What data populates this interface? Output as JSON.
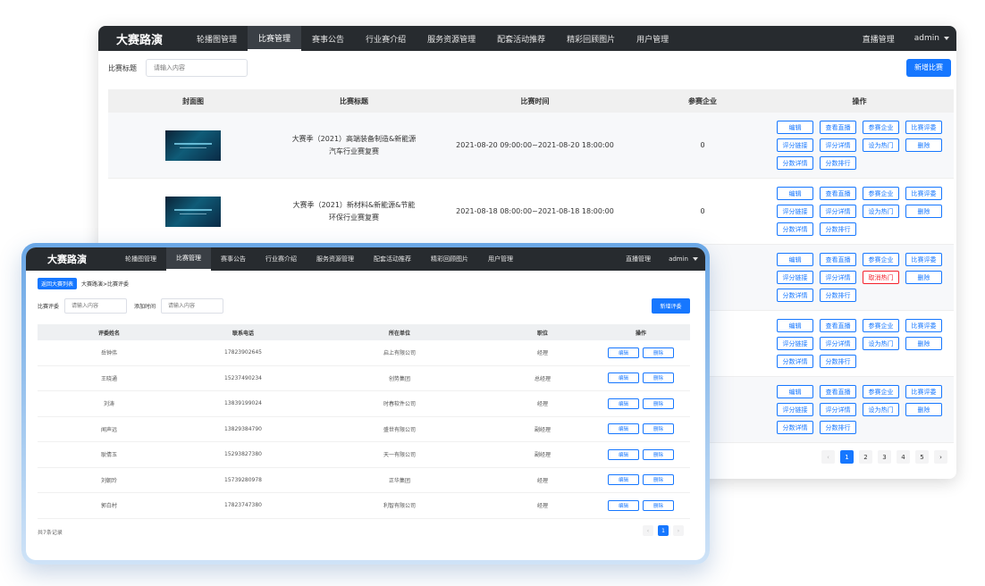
{
  "back": {
    "brand": "大赛路演",
    "nav": [
      "轮播图管理",
      "比赛管理",
      "赛事公告",
      "行业赛介绍",
      "服务资源管理",
      "配套活动推荐",
      "精彩回顾图片",
      "用户管理"
    ],
    "active_nav": 1,
    "live": "直播管理",
    "admin": "admin",
    "filter_label": "比赛标题",
    "filter_placeholder": "请输入内容",
    "add_button": "新增比赛",
    "headers": {
      "cover": "封面图",
      "title": "比赛标题",
      "time": "比赛时间",
      "companies": "参赛企业",
      "ops": "操作"
    },
    "rows": [
      {
        "title": "大赛季（2021）高端装备制造&新能源汽车行业赛复赛",
        "time": "2021-08-20 09:00:00~2021-08-20 18:00:00",
        "companies": "0",
        "hot": "设为热门",
        "hot_red": false
      },
      {
        "title": "大赛季（2021）新材料&新能源&节能环保行业赛复赛",
        "time": "2021-08-18 08:00:00~2021-08-18 18:00:00",
        "companies": "0",
        "hot": "设为热门",
        "hot_red": false
      },
      {
        "title": "",
        "time": "",
        "companies": "",
        "hot": "取消热门",
        "hot_red": true
      },
      {
        "title": "",
        "time": "",
        "companies": "",
        "hot": "设为热门",
        "hot_red": false
      },
      {
        "title": "",
        "time": "",
        "companies": "",
        "hot": "设为热门",
        "hot_red": false
      }
    ],
    "ops": {
      "edit": "编辑",
      "view_live": "查看直播",
      "companies": "参赛企业",
      "judges": "比赛评委",
      "score_link": "评分链接",
      "score_detail": "评分详情",
      "delete": "删除",
      "score_info": "分数详情",
      "score_rank": "分数排行"
    },
    "pager": {
      "prev": "‹",
      "pages": [
        "1",
        "2",
        "3",
        "4",
        "5"
      ],
      "next": "›",
      "current": "1"
    }
  },
  "front": {
    "brand": "大赛路演",
    "nav": [
      "轮播图管理",
      "比赛管理",
      "赛事公告",
      "行业赛介绍",
      "服务资源管理",
      "配套活动推荐",
      "精彩回顾图片",
      "用户管理"
    ],
    "active_nav": 1,
    "live": "直播管理",
    "admin": "admin",
    "back_button": "返回大赛列表",
    "breadcrumb": "大赛路演>比赛评委",
    "filter_judge_label": "比赛评委",
    "filter_judge_placeholder": "请输入内容",
    "filter_time_label": "添加时间",
    "filter_time_placeholder": "请输入内容",
    "add_button": "新增评委",
    "headers": {
      "name": "评委姓名",
      "phone": "联系电话",
      "org": "所在单位",
      "position": "职位",
      "ops": "操作"
    },
    "rows": [
      {
        "name": "岳钟伟",
        "phone": "17823902645",
        "org": "启上有限公司",
        "position": "经理"
      },
      {
        "name": "王晓通",
        "phone": "15237490234",
        "org": "创势集团",
        "position": "总经理"
      },
      {
        "name": "刘涛",
        "phone": "13839199024",
        "org": "时春软件公司",
        "position": "经理"
      },
      {
        "name": "闻声远",
        "phone": "13829384790",
        "org": "盛世有限公司",
        "position": "副经理"
      },
      {
        "name": "耿倩玉",
        "phone": "15293827380",
        "org": "天一有限公司",
        "position": "副经理"
      },
      {
        "name": "刘朝玲",
        "phone": "15739280978",
        "org": "正华集团",
        "position": "经理"
      },
      {
        "name": "郭白村",
        "phone": "17823747380",
        "org": "利智有限公司",
        "position": "经理"
      }
    ],
    "op_edit": "编辑",
    "op_delete": "删除",
    "total": "共7条记录",
    "pager": {
      "prev": "‹",
      "current": "1",
      "next": "›"
    }
  },
  "colors": {
    "primary": "#1677ff",
    "danger": "#f5222d",
    "topbar": "#272b2f"
  }
}
